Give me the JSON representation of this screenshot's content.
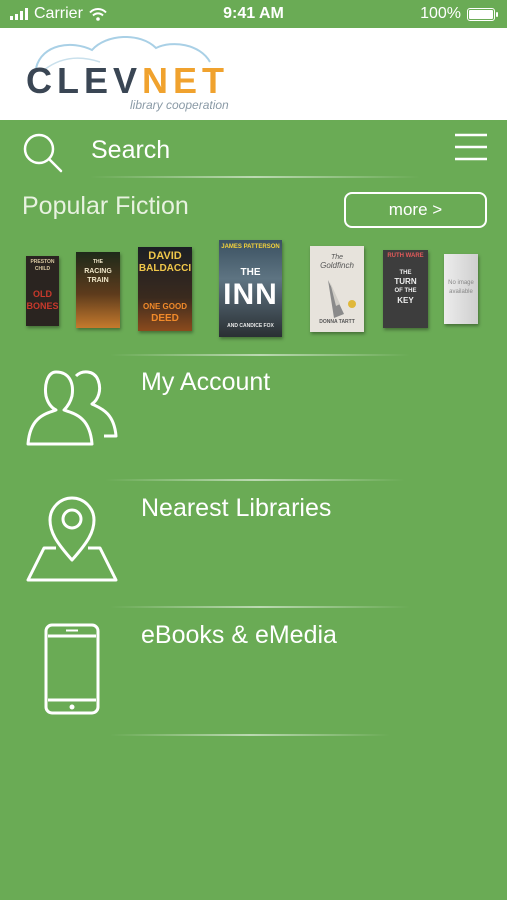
{
  "status_bar": {
    "carrier": "Carrier",
    "time": "9:41 AM",
    "battery": "100%"
  },
  "logo": {
    "brand_prefix": "CLEV",
    "brand_accent": "NET",
    "tagline": "library cooperation"
  },
  "search": {
    "placeholder": "Search"
  },
  "popular_fiction": {
    "title": "Popular Fiction",
    "more_label": "more >",
    "covers": [
      {
        "lines": [
          "PRESTON",
          "CHILD",
          "OLD",
          "BONES"
        ]
      },
      {
        "lines": [
          "THE",
          "RACING",
          "TRAIN"
        ]
      },
      {
        "lines": [
          "DAVID",
          "BALDACCI",
          "ONE GOOD",
          "DEED"
        ]
      },
      {
        "lines": [
          "JAMES PATTERSON",
          "THE",
          "INN",
          "AND CANDICE FOX"
        ]
      },
      {
        "lines": [
          "The",
          "Goldfinch",
          "DONNA TARTT"
        ]
      },
      {
        "lines": [
          "RUTH WARE",
          "THE",
          "TURN",
          "OF THE",
          "KEY"
        ]
      },
      {
        "lines": [
          "No image",
          "available"
        ]
      }
    ]
  },
  "menu": [
    {
      "label": "My Account"
    },
    {
      "label": "Nearest Libraries"
    },
    {
      "label": "eBooks & eMedia"
    }
  ],
  "colors": {
    "background": "#6aab55",
    "logo_dark": "#3a4654",
    "logo_accent": "#f0a22e"
  }
}
